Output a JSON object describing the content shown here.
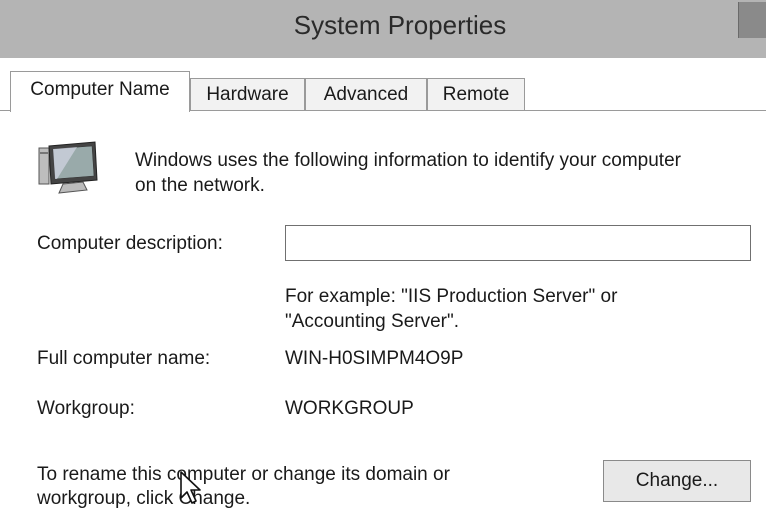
{
  "window": {
    "title": "System Properties"
  },
  "tabs": [
    {
      "label": "Computer Name",
      "active": true
    },
    {
      "label": "Hardware",
      "active": false
    },
    {
      "label": "Advanced",
      "active": false
    },
    {
      "label": "Remote",
      "active": false
    }
  ],
  "intro": {
    "icon": "computer-icon",
    "line1": "Windows uses the following information to identify your computer",
    "line2": "on the network."
  },
  "description": {
    "label": "Computer description:",
    "value": "",
    "example_line1": "For example: \"IIS Production Server\" or",
    "example_line2": "\"Accounting Server\"."
  },
  "full_name": {
    "label": "Full computer name:",
    "value": "WIN-H0SIMPM4O9P"
  },
  "workgroup": {
    "label": "Workgroup:",
    "value": "WORKGROUP"
  },
  "rename": {
    "line1": "To rename this computer or change its domain or",
    "line2": "workgroup, click Change.",
    "button_label": "Change..."
  }
}
